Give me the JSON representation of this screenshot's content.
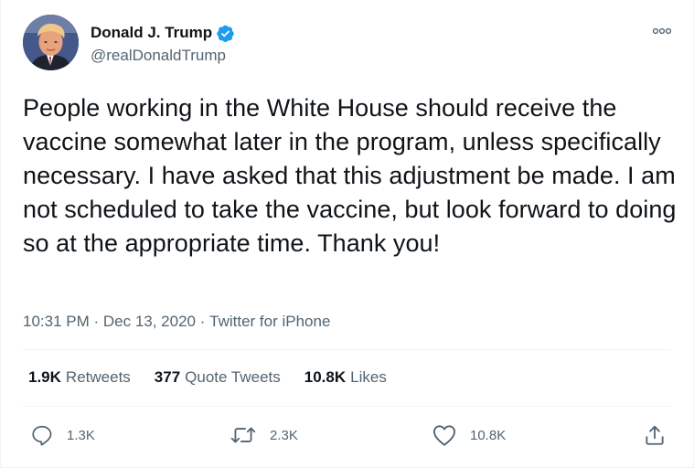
{
  "user": {
    "display_name": "Donald J. Trump",
    "handle": "@realDonaldTrump",
    "verified_icon": "verified-badge-icon",
    "more_icon": "more-dots-icon"
  },
  "tweet": {
    "text": "People working in the White House should receive the vaccine somewhat later in the program, unless specifically necessary. I have asked that this adjustment be made. I am not scheduled to take the vaccine, but look forward to doing so at the appropriate time. Thank you!",
    "time": "10:31 PM",
    "dot1": " · ",
    "date": "Dec 13, 2020",
    "dot2": " · ",
    "source": "Twitter for iPhone"
  },
  "stats": {
    "retweets_count": "1.9K",
    "retweets_label": "Retweets",
    "quotes_count": "377",
    "quotes_label": "Quote Tweets",
    "likes_count": "10.8K",
    "likes_label": "Likes"
  },
  "actions": {
    "reply_count": "1.3K",
    "retweet_count": "2.3K",
    "like_count": "10.8K",
    "share_icon": "share-icon"
  },
  "colors": {
    "text": "#0f1419",
    "secondary": "#536471",
    "verified": "#1d9bf0",
    "divider": "#eff3f4"
  }
}
